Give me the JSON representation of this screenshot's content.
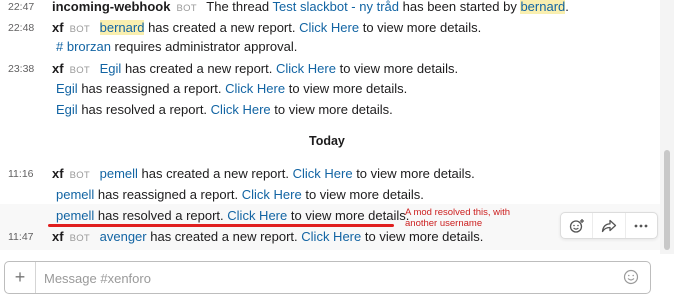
{
  "messages": {
    "r1": {
      "time": "22:47",
      "sender": "incoming-webhook",
      "badge": "BOT",
      "t1": "The thread",
      "link": "Test slackbot - ny tråd",
      "t2": "has been started by",
      "user": "bernard",
      "t3": "."
    },
    "r2": {
      "time": "22:48",
      "sender": "xf",
      "badge": "BOT",
      "user": "bernard",
      "t1": "has created a new report.",
      "link": "Click Here",
      "t2": "to view more details."
    },
    "r3": {
      "channel": "# brorzan",
      "t1": "requires administrator approval."
    },
    "r4": {
      "time": "23:38",
      "sender": "xf",
      "badge": "BOT",
      "user": "Egil",
      "t1": "has created a new report.",
      "link": "Click Here",
      "t2": "to view more details."
    },
    "r5": {
      "user": "Egil",
      "t1": "has reassigned a report.",
      "link": "Click Here",
      "t2": "to view more details."
    },
    "r6": {
      "user": "Egil",
      "t1": "has resolved a report.",
      "link": "Click Here",
      "t2": "to view more details."
    },
    "day_separator": "Today",
    "r7": {
      "time": "11:16",
      "sender": "xf",
      "badge": "BOT",
      "user": "pemell",
      "t1": "has created a new report.",
      "link": "Click Here",
      "t2": "to view more details."
    },
    "r8": {
      "user": "pemell",
      "t1": "has reassigned a report.",
      "link": "Click Here",
      "t2": "to view more details."
    },
    "r9": {
      "user": "pemell",
      "t1": "has resolved a report.",
      "link": "Click Here",
      "t2": "to view more details."
    },
    "r10": {
      "time": "11:47",
      "sender": "xf",
      "badge": "BOT",
      "user": "avenger",
      "t1": "has created a new report.",
      "link": "Click Here",
      "t2": "to view more details."
    }
  },
  "annotation": {
    "line1": "A mod resolved this, with",
    "line2": "another username"
  },
  "message_actions": [
    "add-reaction-icon",
    "share-icon",
    "more-options-icon"
  ],
  "composer": {
    "placeholder": "Message #xenforo",
    "value": ""
  },
  "colors": {
    "link": "#1264a3",
    "highlight": "#f9efb0",
    "annotation": "#cc2020",
    "underline": "#e01e1e"
  }
}
